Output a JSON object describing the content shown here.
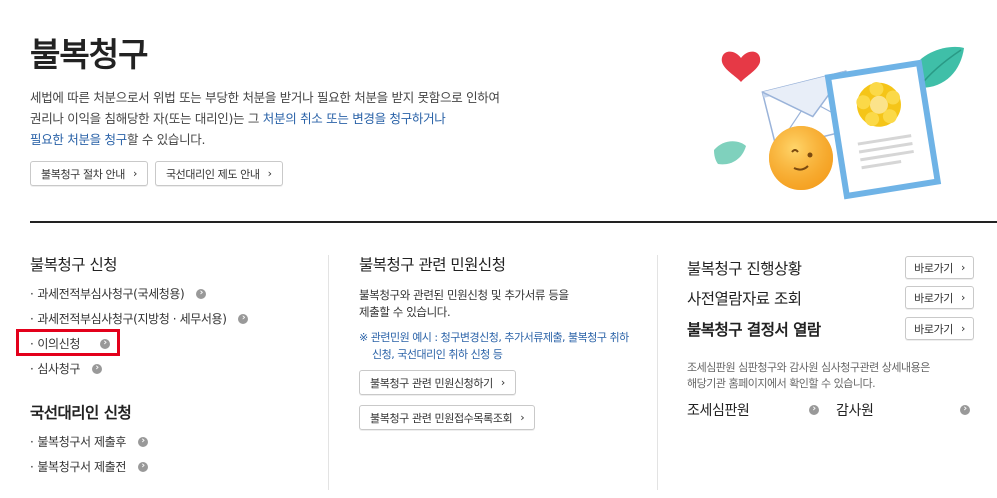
{
  "hero": {
    "title": "불복청구",
    "desc_1": "세법에 따른 처분으로서 위법 또는 부당한 처분을 받거나 필요한 처분을 받지 못함으로 인하여",
    "desc_2a": "권리나 이익을 침해당한 자(또는 대리인)는 그 ",
    "desc_2b": "처분의 취소 또는 변경을 청구하거나",
    "desc_3a": "필요한 처분을 청구",
    "desc_3b": "할 수 있습니다.",
    "btn_procedure": "불복청구 절차 안내",
    "btn_proxy": "국선대리인 제도 안내"
  },
  "left": {
    "title_apply": "불복청구 신청",
    "items": [
      "과세전적부심사청구(국세청용)",
      "과세전적부심사청구(지방청 · 세무서용)",
      "이의신청",
      "심사청구"
    ],
    "title_proxy": "국선대리인 신청",
    "proxy_items": [
      "불복청구서 제출후",
      "불복청구서 제출전"
    ]
  },
  "middle": {
    "title": "불복청구 관련 민원신청",
    "text_1": "불복청구와 관련된 민원신청 및 추가서류 등을",
    "text_2": "제출할 수 있습니다.",
    "note_1": "※ 관련민원 예시 : 청구변경신청, 추가서류제출, 불복청구 취하",
    "note_2": "신청, 국선대리인 취하 신청 등",
    "btn_apply": "불복청구 관련 민원신청하기",
    "btn_inquiry": "불복청구 관련 민원접수목록조회"
  },
  "right": {
    "rows": [
      {
        "label": "불복청구 진행상황",
        "button": "바로가기",
        "bold": false
      },
      {
        "label": "사전열람자료 조회",
        "button": "바로가기",
        "bold": false
      },
      {
        "label": "불복청구 결정서 열람",
        "button": "바로가기",
        "bold": true
      }
    ],
    "note_1": "조세심판원 심판청구와 감사원 심사청구관련 상세내용은",
    "note_2": "해당기관 홈페이지에서 확인할 수 있습니다.",
    "org_1": "조세심판원",
    "org_2": "감사원"
  },
  "colors": {
    "accent_blue": "#2b63a8",
    "highlight_red": "#e3001b",
    "divider": "#222222"
  }
}
